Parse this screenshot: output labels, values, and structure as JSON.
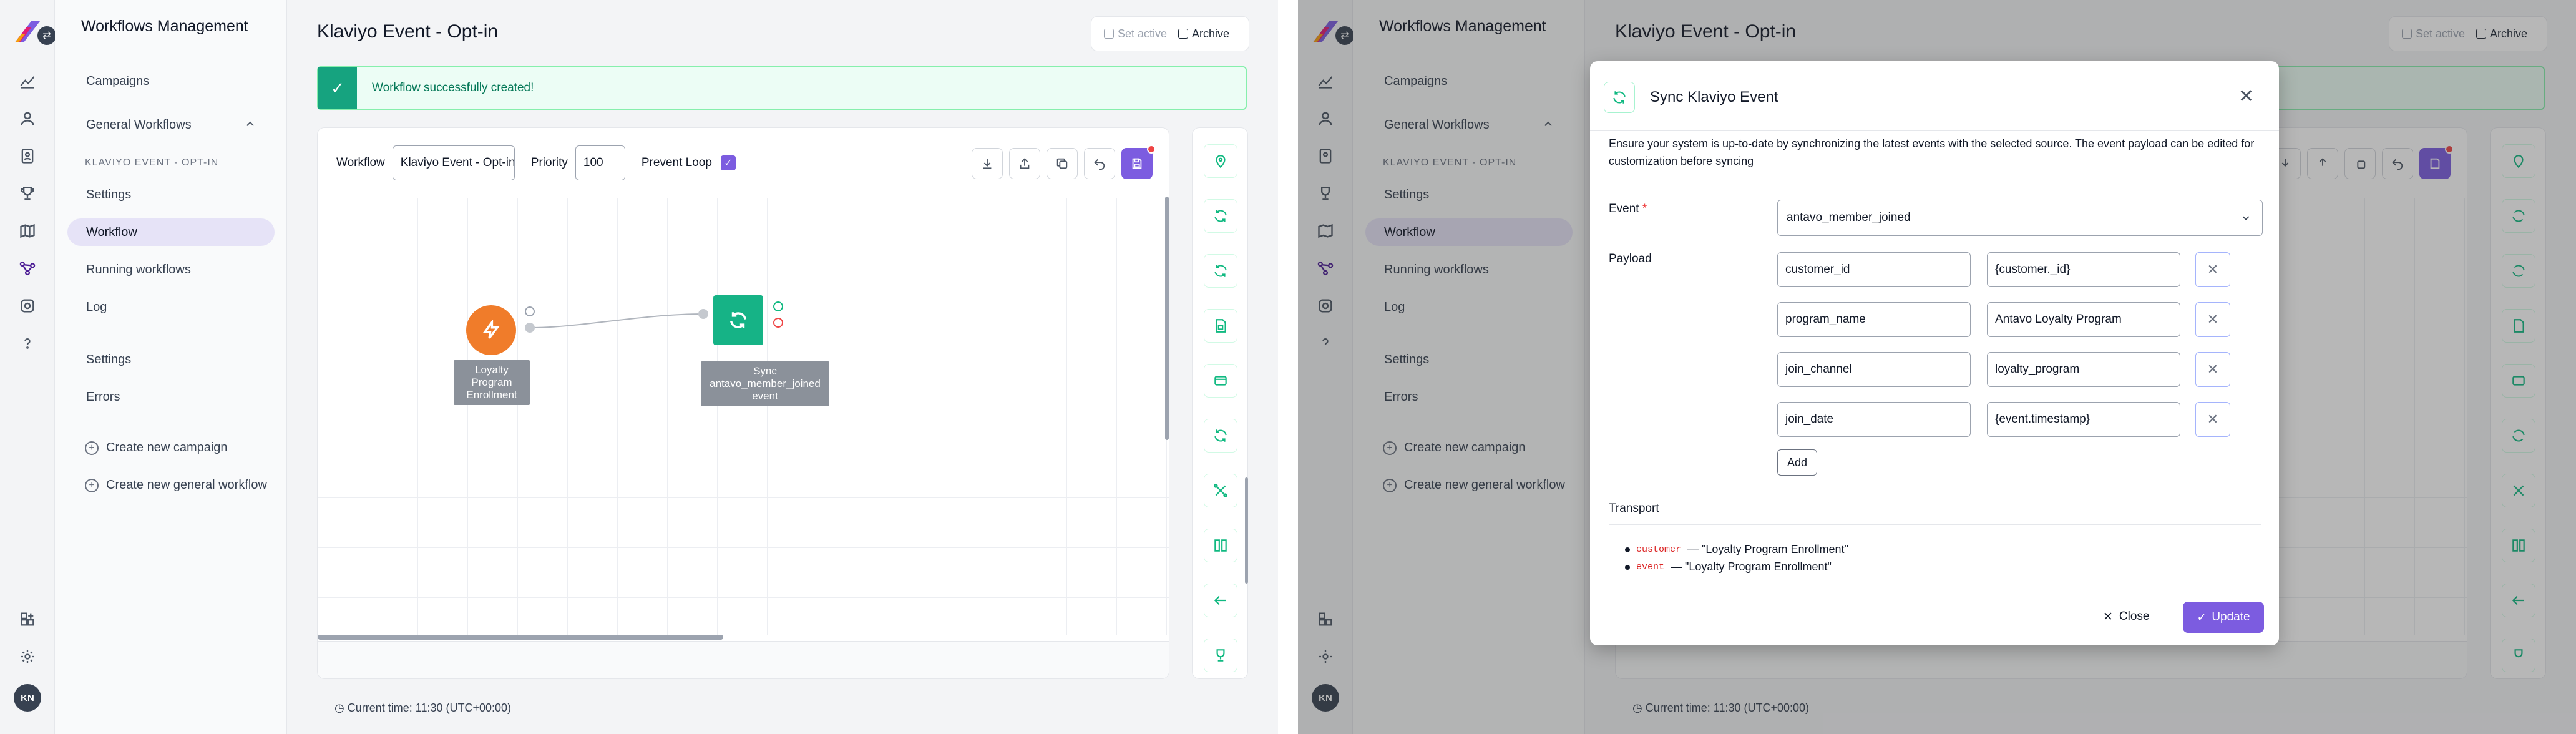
{
  "app": {
    "title": "Workflows Management",
    "avatar_initials": "KN",
    "logo_colors": [
      "#7c5ce0",
      "#e11d74",
      "#f59e0b"
    ]
  },
  "nav": {
    "campaigns": "Campaigns",
    "general_workflows": "General Workflows",
    "section": "KLAVIYO EVENT - OPT-IN",
    "settings": "Settings",
    "workflow": "Workflow",
    "running": "Running workflows",
    "log": "Log",
    "settings2": "Settings",
    "errors": "Errors",
    "create_campaign": "Create new campaign",
    "create_workflow": "Create new general workflow"
  },
  "page": {
    "title": "Klaviyo Event - Opt-in",
    "set_active": "Set active",
    "archive": "Archive",
    "toast": "Workflow successfully created!",
    "current_time": "Current time: 11:30 (UTC+00:00)"
  },
  "toolbar": {
    "workflow_label": "Workflow",
    "workflow_value": "Klaviyo Event - Opt-in",
    "priority_label": "Priority",
    "priority_value": "100",
    "prevent_loop_label": "Prevent Loop",
    "prevent_loop_checked": true
  },
  "nodes": {
    "trigger_label": "Loyalty Program Enrollment",
    "trigger_color": "#f07c2a",
    "action_label": "Sync antavo_member_joined event",
    "action_color": "#16b386"
  },
  "modal": {
    "title": "Sync Klaviyo Event",
    "description": "Ensure your system is up-to-date by synchronizing the latest events with the selected source. The event payload can be edited for customization before syncing",
    "event_label": "Event",
    "event_value": "antavo_member_joined",
    "payload_label": "Payload",
    "payload": [
      {
        "key": "customer_id",
        "value": "{customer._id}"
      },
      {
        "key": "program_name",
        "value": "Antavo Loyalty Program"
      },
      {
        "key": "join_channel",
        "value": "loyalty_program"
      },
      {
        "key": "join_date",
        "value": "{event.timestamp}"
      }
    ],
    "add_label": "Add",
    "transport_label": "Transport",
    "transport": [
      {
        "code": "customer",
        "text": "— \"Loyalty Program Enrollment\""
      },
      {
        "code": "event",
        "text": "— \"Loyalty Program Enrollment\""
      }
    ],
    "close_label": "Close",
    "update_label": "Update"
  }
}
